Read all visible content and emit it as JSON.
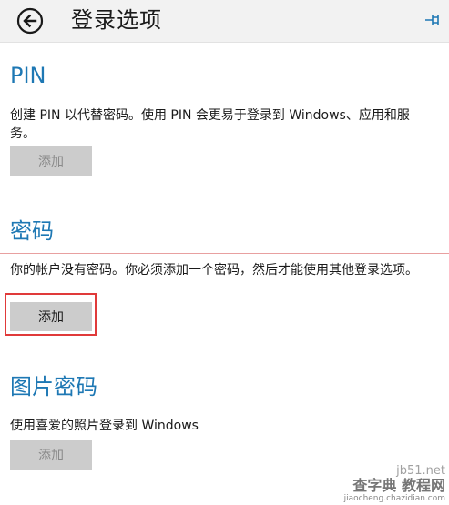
{
  "header": {
    "title": "登录选项"
  },
  "sections": {
    "pin": {
      "title": "PIN",
      "description": "创建 PIN 以代替密码。使用 PIN 会更易于登录到 Windows、应用和服务。",
      "button_label": "添加"
    },
    "password": {
      "title": "密码",
      "description": "你的帐户没有密码。你必须添加一个密码，然后才能使用其他登录选项。",
      "button_label": "添加"
    },
    "picture_password": {
      "title": "图片密码",
      "description": "使用喜爱的照片登录到 Windows",
      "button_label": "添加"
    }
  },
  "watermark": {
    "site": "jb51.net",
    "main": "查字典 教程网",
    "url": "jiaocheng.chazidian.com"
  },
  "colors": {
    "accent": "#1e78b4",
    "highlight": "#e03a3a",
    "button_bg": "#cccccc",
    "header_bg": "#f2f2f2"
  },
  "icons": {
    "back": "back-arrow-circle-icon",
    "pin": "pin-icon"
  }
}
